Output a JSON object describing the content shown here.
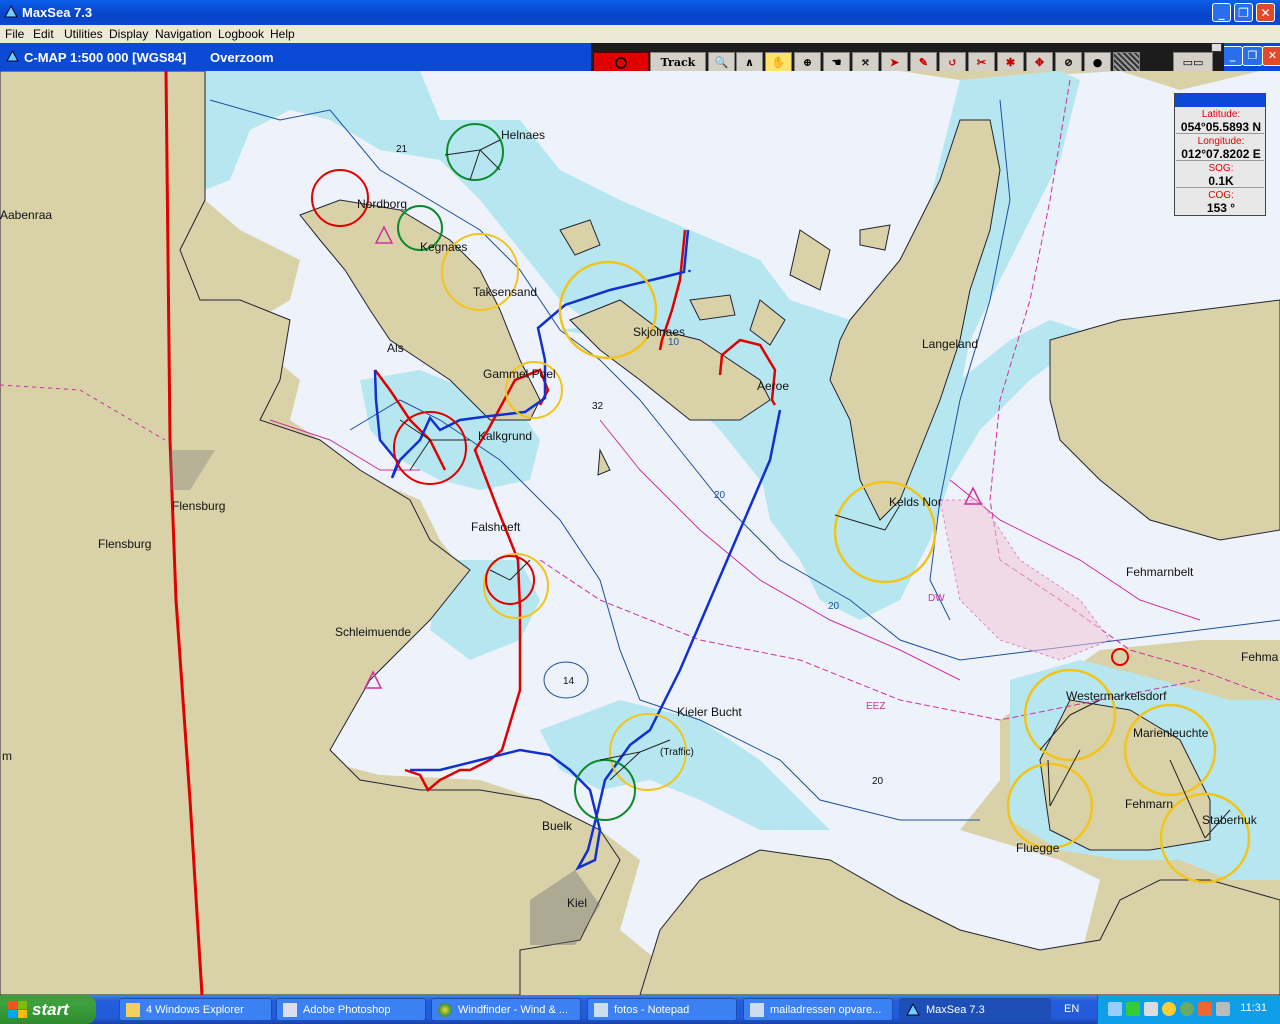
{
  "window": {
    "title": "MaxSea 7.3"
  },
  "menu": [
    "File",
    "Edit",
    "Utilities",
    "Display",
    "Navigation",
    "Logbook",
    "Help"
  ],
  "chart_header": {
    "label": "C-MAP  1:500 000 [WGS84]",
    "zoom_status": "Overzoom"
  },
  "toolbar": {
    "track_label": "Track off"
  },
  "nav_display": {
    "latitude_caption": "Latitude:",
    "latitude": "054°05.5893 N",
    "longitude_caption": "Longitude:",
    "longitude": "012°07.8202 E",
    "sog_caption": "SOG:",
    "sog": "0.1K",
    "cog_caption": "COG:",
    "cog": "153 °"
  },
  "places": {
    "helnaes": "Helnaes",
    "nordborg": "Nordborg",
    "aabenraa": "Aabenraa",
    "kegnaes": "Kegnaes",
    "taksensand": "Taksensand",
    "als": "Als",
    "skjolnaes": "Skjolnaes",
    "gammel_poel": "Gammel Poel",
    "aeroe": "Aeroe",
    "langeland": "Langeland",
    "kalkgrund": "Kalkgrund",
    "flensburg1": "Flensburg",
    "flensburg2": "Flensburg",
    "falshoeft": "Falshoeft",
    "keldsnor": "Kelds Nor",
    "fehmarnbelt": "Fehmarnbelt",
    "schleimuende": "Schleimuende",
    "kieler_bucht": "Kieler Bucht",
    "westermarkelsdorf": "Westermarkelsdorf",
    "marienleuchte": "Marienleuchte",
    "fehmarn": "Fehmarn",
    "fehmarn_edge": "Fehma",
    "buelk": "Buelk",
    "fluegge": "Fluegge",
    "staberhuk": "Staberhuk",
    "kiel": "Kiel",
    "traffic": "(Traffic)",
    "m_edge": "m"
  },
  "soundings": {
    "s21": "21",
    "s32": "32",
    "s14": "14",
    "s20a": "20",
    "s20b": "20"
  },
  "depth_labels": {
    "d10": "10",
    "d20": "20",
    "dw": "DW",
    "eez": "EEZ"
  },
  "taskbar": {
    "start_label": "start",
    "items": [
      "4 Windows Explorer",
      "Adobe Photoshop",
      "Windfinder - Wind & ...",
      "fotos - Notepad",
      "mailadressen opvare...",
      "MaxSea 7.3"
    ],
    "language": "EN",
    "clock": "11:31"
  },
  "colors": {
    "land": "#d9d2a8",
    "shallow": "#b6e7f0",
    "deep": "#eef2fa",
    "track_red": "#e00000",
    "route_blue": "#1030d0",
    "accent": "#0a4ad6"
  }
}
